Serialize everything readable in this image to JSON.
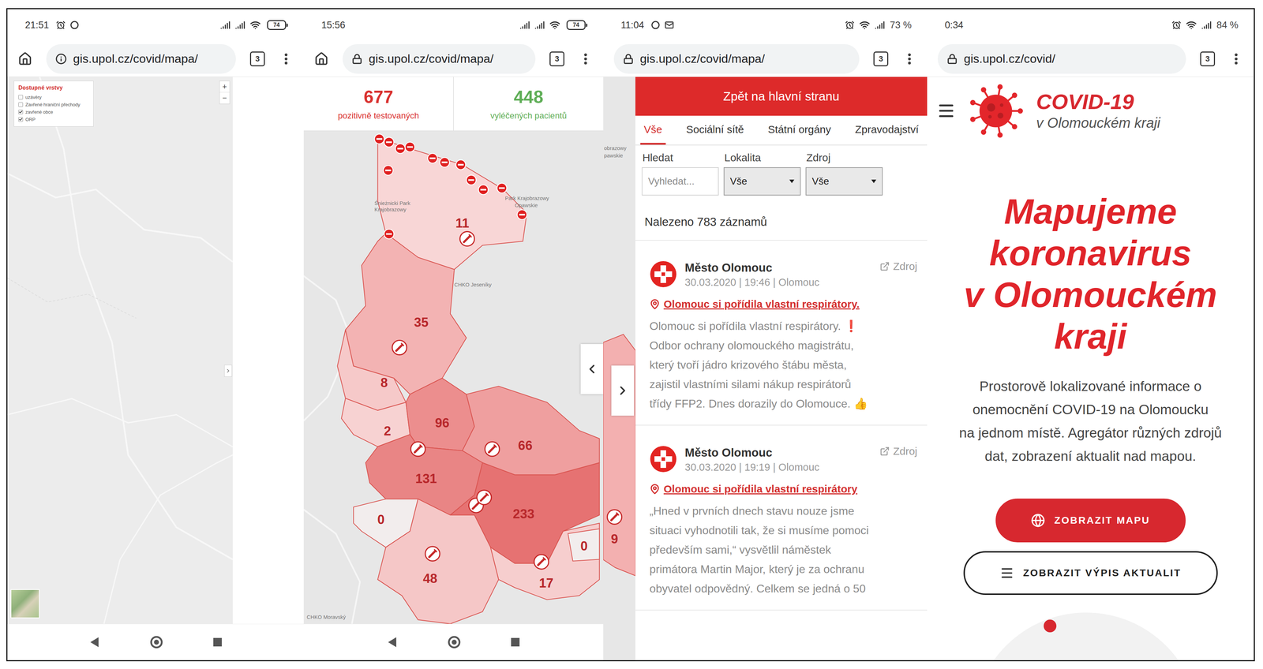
{
  "layers_screen": {
    "status": {
      "time": "21:51",
      "battery": {
        "kind": "icon",
        "reading": "74"
      }
    },
    "browser": {
      "url": "gis.upol.cz/covid/mapa/",
      "tab_count": "3",
      "secure": false,
      "home_button": true
    },
    "legend": {
      "title": "Dostupné vrstvy",
      "layers": [
        {
          "label": "uzávěry",
          "checked": false
        },
        {
          "label": "Zavřené hraniční přechody",
          "checked": false
        },
        {
          "label": "zavřené obce",
          "checked": true
        },
        {
          "label": "ORP",
          "checked": true
        }
      ]
    },
    "zoom": {
      "zoom_in": "+",
      "zoom_out": "−"
    }
  },
  "districts_screen": {
    "status": {
      "time": "15:56",
      "battery": {
        "kind": "icon",
        "reading": "74"
      }
    },
    "browser": {
      "url": "gis.upol.cz/covid/mapa/",
      "tab_count": "3",
      "secure": true,
      "home_button": true
    },
    "stats": [
      {
        "value": "677",
        "label": "pozitivně testovaných",
        "color": "#d9312f"
      },
      {
        "value": "448",
        "label": "vyléčených pacientů",
        "color": "#5fae57"
      }
    ],
    "map": {
      "districts": [
        {
          "count": "11",
          "color": "#f8d6d6"
        },
        {
          "count": "35",
          "color": "#f3b3b3"
        },
        {
          "count": "8",
          "color": "#f6c9c9"
        },
        {
          "count": "2",
          "color": "#f7d2d2"
        },
        {
          "count": "96",
          "color": "#ec8e8e"
        },
        {
          "count": "66",
          "color": "#ef9f9f"
        },
        {
          "count": "131",
          "color": "#e98585"
        },
        {
          "count": "233",
          "color": "#e67272"
        },
        {
          "count": "0",
          "color": "#f2eded"
        },
        {
          "count": "48",
          "color": "#f5c7c7"
        },
        {
          "count": "17",
          "color": "#f6cece"
        },
        {
          "count": "0",
          "color": "#f2eded"
        }
      ],
      "labels": [
        "Śnieżnicki Park",
        "Krajobrazowy",
        "Park Krajobrazowy",
        "Opawskie",
        "CHKO Jeseníky",
        "CHKO Moravský"
      ]
    }
  },
  "news_screen": {
    "status": {
      "time": "11:04",
      "battery": {
        "kind": "percent",
        "reading": "73 %"
      }
    },
    "browser": {
      "url": "gis.upol.cz/covid/mapa/",
      "tab_count": "3",
      "secure": true,
      "home_button": false
    },
    "map_edge": {
      "labels": [
        "obrazowy",
        "pawskie"
      ],
      "count": "9"
    },
    "back_button": "Zpět na hlavní stranu",
    "tabs": [
      {
        "label": "Vše",
        "selected": true
      },
      {
        "label": "Sociální sítě",
        "selected": false
      },
      {
        "label": "Státní orgány",
        "selected": false
      },
      {
        "label": "Zpravodajství",
        "selected": false
      }
    ],
    "filters": [
      {
        "label": "Hledat",
        "kind": "input",
        "text": "Vyhledat..."
      },
      {
        "label": "Lokalita",
        "kind": "select",
        "text": "Vše"
      },
      {
        "label": "Zdroj",
        "kind": "select",
        "text": "Vše"
      }
    ],
    "result_count": "Nalezeno 783 záznamů",
    "posts": [
      {
        "author": "Město Olomouc",
        "meta": "30.03.2020 | 19:46 | Olomouc",
        "source": "Zdroj",
        "title": "Olomouc si pořídila vlastní respirátory.",
        "lines": [
          "Olomouc si pořídila vlastní respirátory. ❗",
          "Odbor ochrany olomouckého magistrátu,",
          "který tvoří jádro krizového štábu města,",
          "zajistil vlastními silami nákup respirátorů",
          "třídy FFP2. Dnes dorazily do Olomouce. 👍"
        ]
      },
      {
        "author": "Město Olomouc",
        "meta": "30.03.2020 | 19:19 | Olomouc",
        "source": "Zdroj",
        "title": "Olomouc si pořídila vlastní respirátory",
        "lines": [
          "„Hned v prvních dnech stavu nouze jsme",
          "situaci vyhodnotili tak, že si musíme pomoci",
          "především sami,“ vysvětlil náměstek",
          "primátora Martin Major, který je za ochranu",
          "obyvatel odpovědný. Celkem se jedná o 50"
        ]
      }
    ]
  },
  "home_screen": {
    "status": {
      "time": "0:34",
      "battery": {
        "kind": "percent",
        "reading": "84 %"
      }
    },
    "browser": {
      "url": "gis.upol.cz/covid/",
      "tab_count": "3",
      "secure": true,
      "home_button": false
    },
    "brand": {
      "title": "COVID-19",
      "subtitle": "v Olomouckém kraji"
    },
    "hero": {
      "lines": [
        "Mapujeme",
        "koronavirus",
        "v Olomouckém",
        "kraji"
      ]
    },
    "description": {
      "lines": [
        "Prostorově lokalizované informace o",
        "onemocnění COVID-19 na Olomoucku",
        "na jednom místě. Agregátor různých zdrojů",
        "dat, zobrazení aktualit nad mapou."
      ]
    },
    "buttons": [
      {
        "label": "ZOBRAZIT MAPU",
        "kind": "primary"
      },
      {
        "label": "ZOBRAZIT VÝPIS AKTUALIT",
        "kind": "secondary"
      }
    ]
  }
}
